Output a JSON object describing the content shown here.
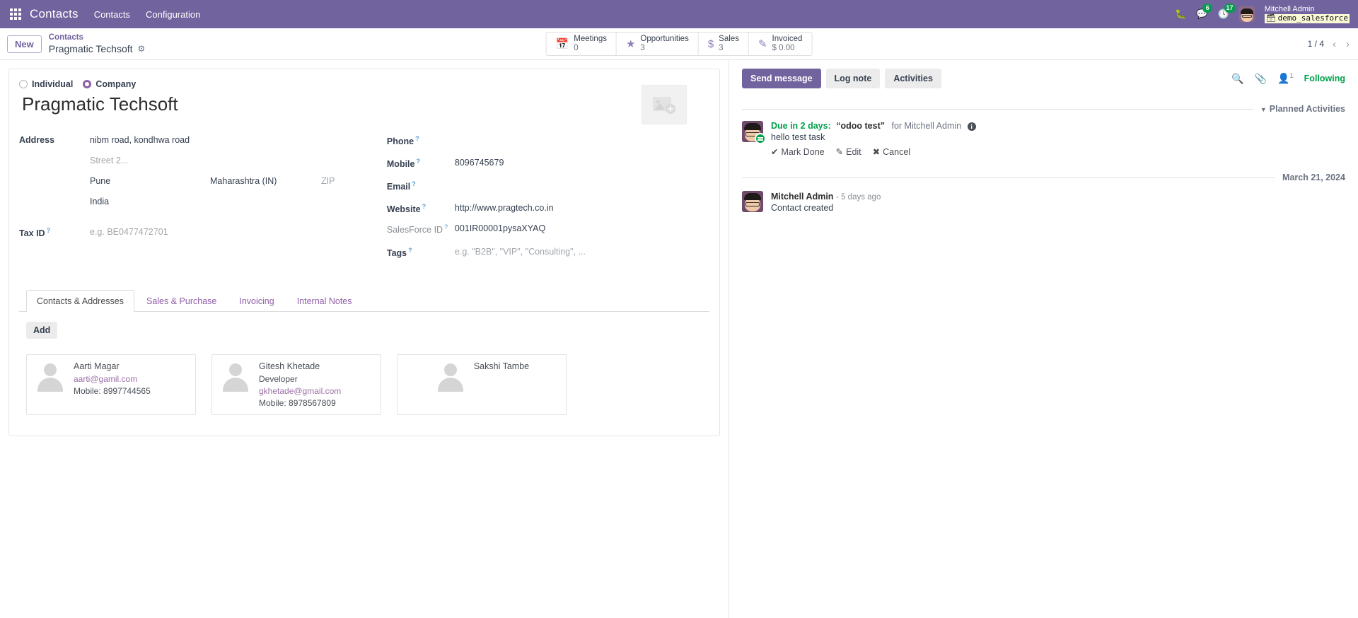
{
  "navbar": {
    "apps_icon": "apps-grid-icon",
    "app_title": "Contacts",
    "menus": [
      "Contacts",
      "Configuration"
    ],
    "bug_icon": "bug-icon",
    "messages_icon": "messages-icon",
    "messages_count": "6",
    "activities_icon": "clock-icon",
    "activities_count": "17",
    "user_name": "Mitchell Admin",
    "database": "demo_salesforce",
    "db_icon": "database-icon"
  },
  "control_panel": {
    "new_label": "New",
    "breadcrumb_parent": "Contacts",
    "breadcrumb_current": "Pragmatic Techsoft",
    "gear_icon": "gear-icon",
    "pager_text": "1 / 4",
    "prev_icon": "chevron-left-icon",
    "next_icon": "chevron-right-icon",
    "stats": [
      {
        "icon": "calendar-icon",
        "label": "Meetings",
        "value": "0"
      },
      {
        "icon": "star-icon",
        "label": "Opportunities",
        "value": "3"
      },
      {
        "icon": "dollar-icon",
        "label": "Sales",
        "value": "3"
      },
      {
        "icon": "pencil-square-icon",
        "label": "Invoiced",
        "value": "$ 0.00"
      }
    ]
  },
  "form": {
    "type_options": [
      {
        "label": "Individual",
        "selected": false
      },
      {
        "label": "Company",
        "selected": true
      }
    ],
    "title": "Pragmatic Techsoft",
    "image_placeholder_icon": "image-add-icon",
    "address": {
      "label": "Address",
      "street": "nibm road, kondhwa road",
      "street2_placeholder": "Street 2...",
      "city": "Pune",
      "state": "Maharashtra (IN)",
      "zip_placeholder": "ZIP",
      "country": "India"
    },
    "tax_id": {
      "label": "Tax ID",
      "placeholder": "e.g. BE0477472701"
    },
    "phone": {
      "label": "Phone",
      "value": ""
    },
    "mobile": {
      "label": "Mobile",
      "value": "8096745679"
    },
    "email": {
      "label": "Email",
      "value": ""
    },
    "website": {
      "label": "Website",
      "value": "http://www.pragtech.co.in"
    },
    "salesforce_id": {
      "label": "SalesForce ID",
      "value": "001IR00001pysaXYAQ"
    },
    "tags": {
      "label": "Tags",
      "placeholder": "e.g. \"B2B\", \"VIP\", \"Consulting\", ..."
    }
  },
  "notebook": {
    "tabs": [
      {
        "label": "Contacts & Addresses",
        "active": true
      },
      {
        "label": "Sales & Purchase",
        "active": false
      },
      {
        "label": "Invoicing",
        "active": false
      },
      {
        "label": "Internal Notes",
        "active": false
      }
    ],
    "add_label": "Add",
    "contacts": [
      {
        "name": "Aarti Magar",
        "function": "",
        "email": "aarti@gamil.com",
        "phone": "Mobile: 8997744565"
      },
      {
        "name": "Gitesh Khetade",
        "function": "Developer",
        "email": "gkhetade@gmail.com",
        "phone": "Mobile: 8978567809"
      },
      {
        "name": "Sakshi Tambe",
        "function": "",
        "email": "",
        "phone": ""
      }
    ]
  },
  "chatter": {
    "send_message": "Send message",
    "log_note": "Log note",
    "activities": "Activities",
    "search_icon": "search-icon",
    "attachment_icon": "paperclip-icon",
    "followers_icon": "user-icon",
    "followers_count": "1",
    "following_label": "Following",
    "planned_activities_title": "Planned Activities",
    "activity": {
      "due": "Due in 2 days:",
      "summary": "“odoo test”",
      "assignee": "for Mitchell Admin",
      "info_icon": "info-icon",
      "note": "hello test task",
      "mark_done": "Mark Done",
      "mark_done_icon": "check-icon",
      "edit": "Edit",
      "edit_icon": "pencil-icon",
      "cancel": "Cancel",
      "cancel_icon": "close-icon"
    },
    "date_separator": "March 21, 2024",
    "message": {
      "author": "Mitchell Admin",
      "time": "- 5 days ago",
      "body": "Contact created"
    }
  }
}
